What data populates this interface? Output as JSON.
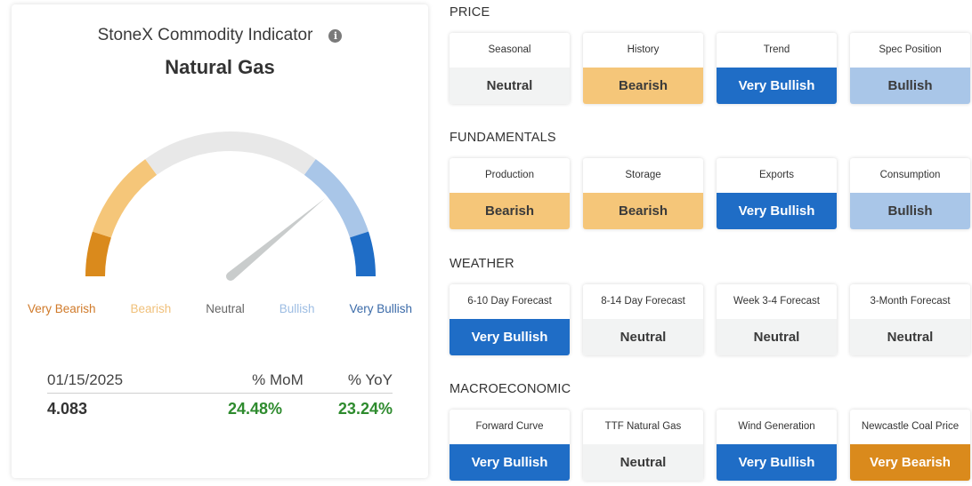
{
  "indicator": {
    "title": "StoneX Commodity Indicator",
    "commodity": "Natural Gas",
    "info_icon": "info-icon",
    "gauge_level": 0.78,
    "scale": [
      {
        "label": "Very Bearish",
        "color": "#da8a1c"
      },
      {
        "label": "Bearish",
        "color": "#f5c679"
      },
      {
        "label": "Neutral",
        "color": "#e8e8e8"
      },
      {
        "label": "Bullish",
        "color": "#a9c6e8"
      },
      {
        "label": "Very Bullish",
        "color": "#1f6dc6"
      }
    ],
    "label_colors": [
      "#d07a2a",
      "#f0c07a",
      "#666666",
      "#9dbde3",
      "#3a6aa8"
    ],
    "stats": {
      "date": "01/15/2025",
      "mom_label": "% MoM",
      "yoy_label": "% YoY",
      "price": "4.083",
      "mom": "24.48%",
      "yoy": "23.24%"
    }
  },
  "sections": [
    {
      "name": "PRICE",
      "tiles": [
        {
          "label": "Seasonal",
          "value": "Neutral",
          "state": "neutral"
        },
        {
          "label": "History",
          "value": "Bearish",
          "state": "bearish"
        },
        {
          "label": "Trend",
          "value": "Very Bullish",
          "state": "very-bullish"
        },
        {
          "label": "Spec Position",
          "value": "Bullish",
          "state": "bullish"
        }
      ]
    },
    {
      "name": "FUNDAMENTALS",
      "tiles": [
        {
          "label": "Production",
          "value": "Bearish",
          "state": "bearish"
        },
        {
          "label": "Storage",
          "value": "Bearish",
          "state": "bearish"
        },
        {
          "label": "Exports",
          "value": "Very Bullish",
          "state": "very-bullish"
        },
        {
          "label": "Consumption",
          "value": "Bullish",
          "state": "bullish"
        }
      ]
    },
    {
      "name": "WEATHER",
      "tiles": [
        {
          "label": "6-10 Day Forecast",
          "value": "Very Bullish",
          "state": "very-bullish"
        },
        {
          "label": "8-14 Day Forecast",
          "value": "Neutral",
          "state": "neutral"
        },
        {
          "label": "Week 3-4 Forecast",
          "value": "Neutral",
          "state": "neutral"
        },
        {
          "label": "3-Month Forecast",
          "value": "Neutral",
          "state": "neutral"
        }
      ]
    },
    {
      "name": "MACROECONOMIC",
      "tiles": [
        {
          "label": "Forward Curve",
          "value": "Very Bullish",
          "state": "very-bullish"
        },
        {
          "label": "TTF Natural Gas",
          "value": "Neutral",
          "state": "neutral"
        },
        {
          "label": "Wind Generation",
          "value": "Very Bullish",
          "state": "very-bullish"
        },
        {
          "label": "Newcastle Coal Price",
          "value": "Very Bearish",
          "state": "very-bearish"
        }
      ]
    }
  ]
}
